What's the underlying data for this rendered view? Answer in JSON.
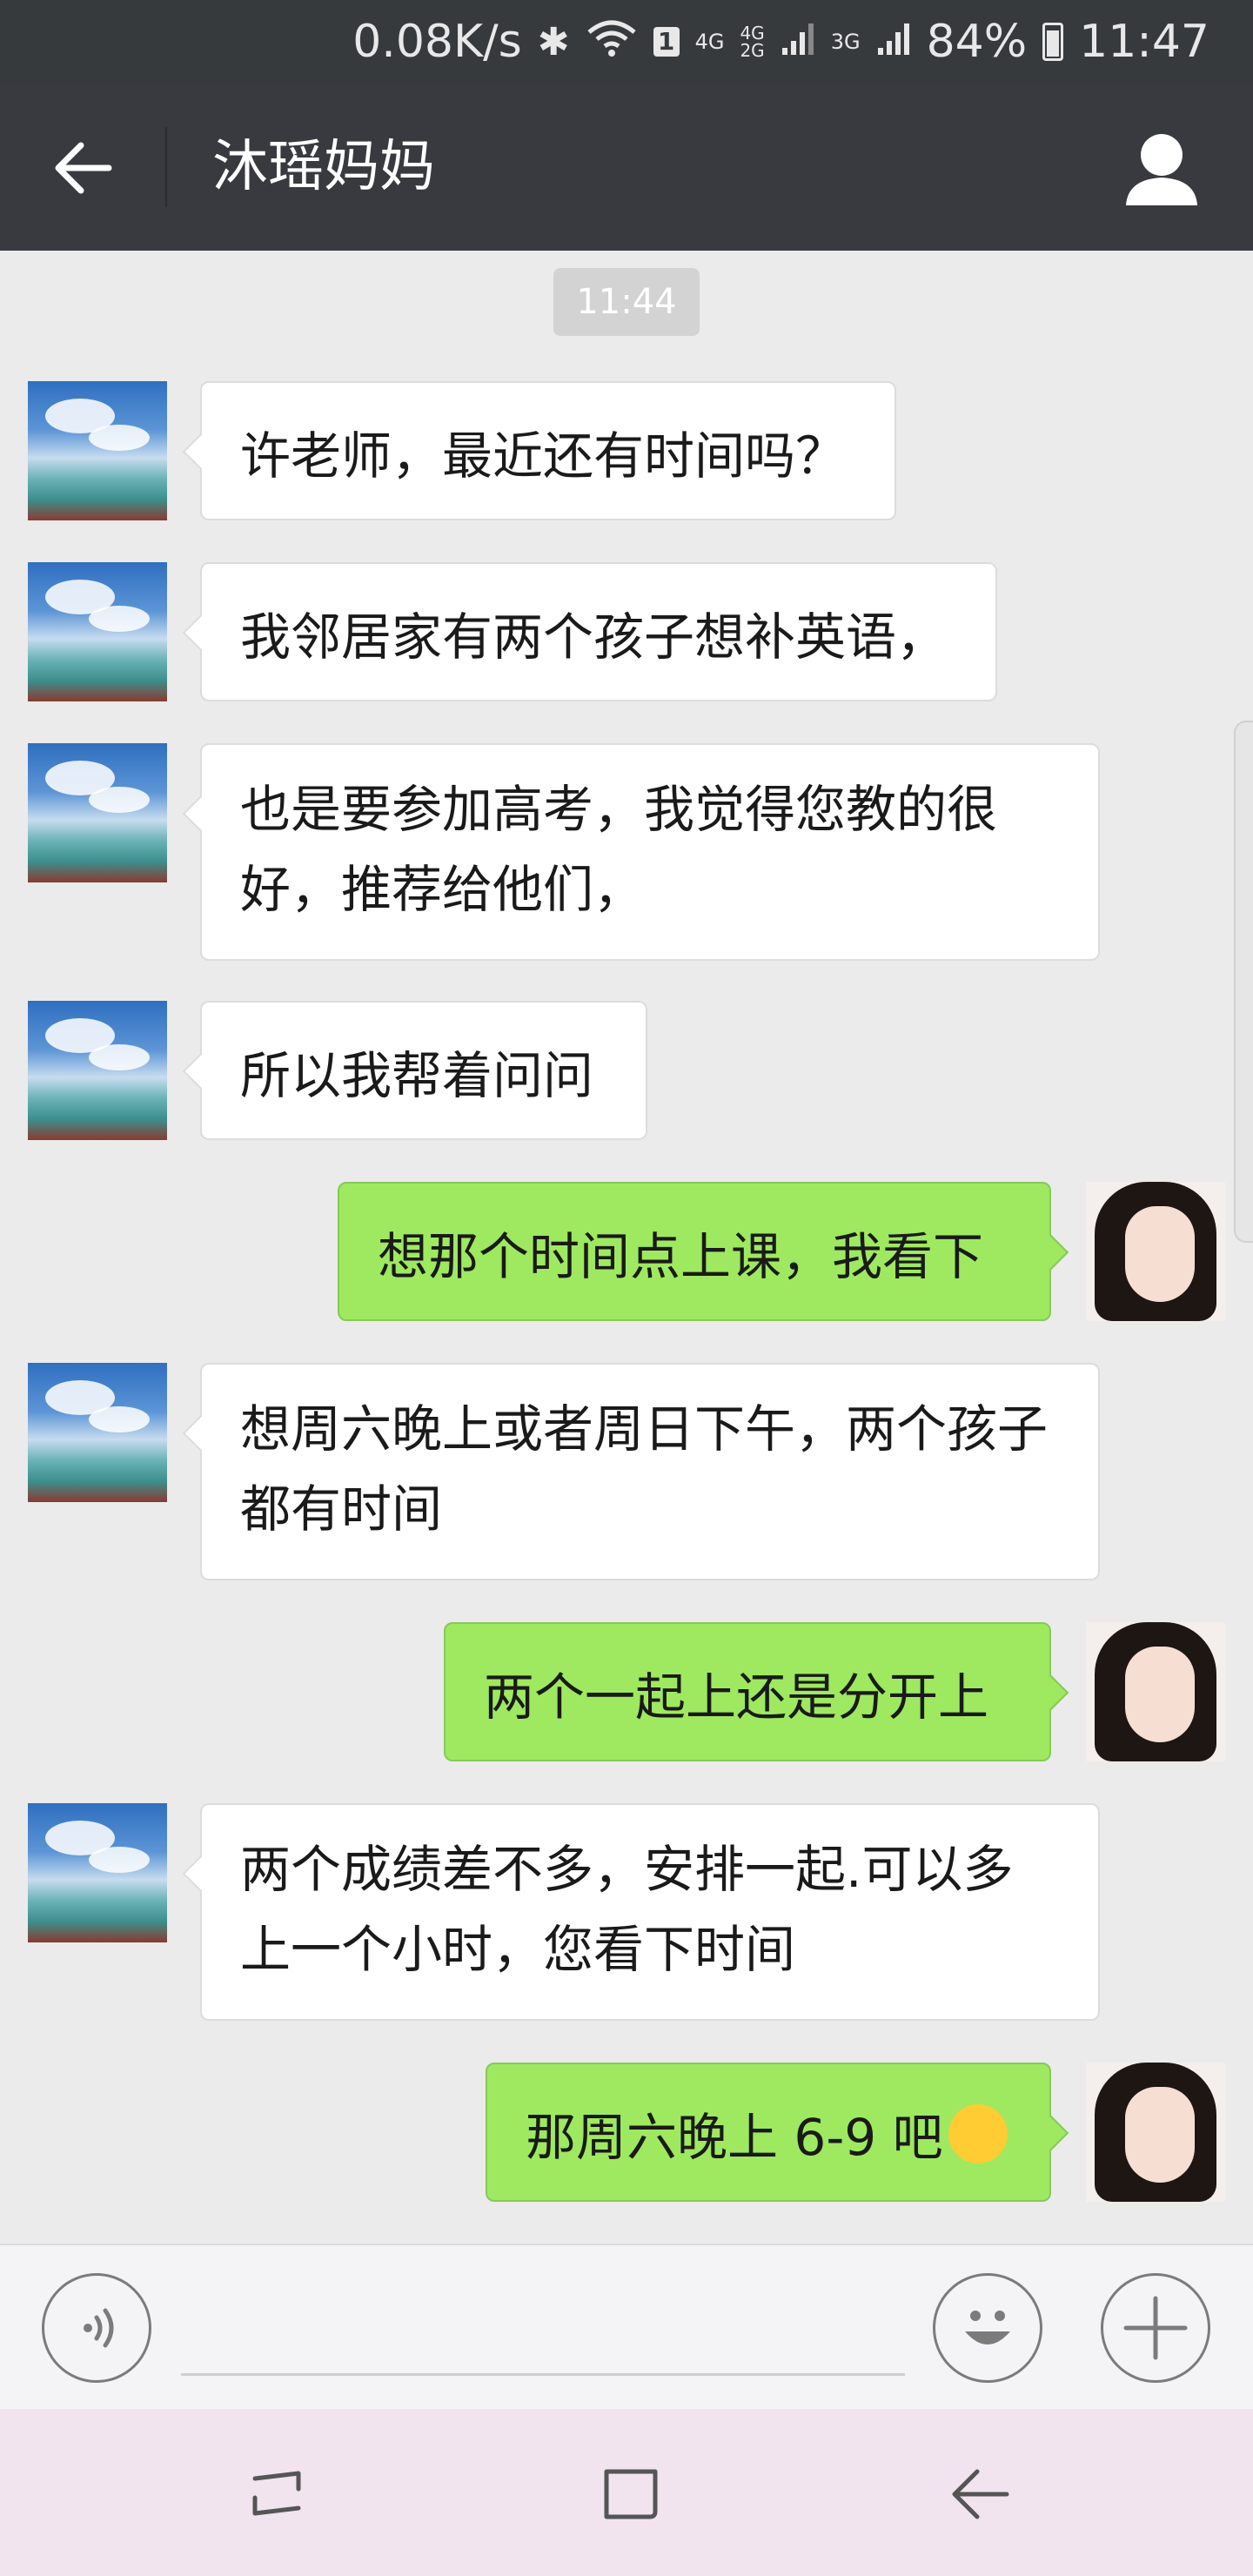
{
  "status_bar": {
    "net_speed": "0.08K/s",
    "sim_badge": "1",
    "net1": "4G",
    "net2_top": "4G",
    "net2_bottom": "2G",
    "net3": "3G",
    "battery": "84%",
    "time": "11:47"
  },
  "header": {
    "title": "沐瑶妈妈"
  },
  "chat": {
    "timestamp": "11:44",
    "messages": [
      {
        "side": "left",
        "text": "许老师，最近还有时间吗？"
      },
      {
        "side": "left",
        "text": "我邻居家有两个孩子想补英语，"
      },
      {
        "side": "left",
        "text": "也是要参加高考，我觉得您教的很好，推荐给他们，"
      },
      {
        "side": "left",
        "text": "所以我帮着问问"
      },
      {
        "side": "right",
        "text": "想那个时间点上课，我看下"
      },
      {
        "side": "left",
        "text": "想周六晚上或者周日下午，两个孩子都有时间"
      },
      {
        "side": "right",
        "text": "两个一起上还是分开上"
      },
      {
        "side": "left",
        "text": "两个成绩差不多，安排一起.可以多上一个小时，您看下时间"
      },
      {
        "side": "right",
        "text": "那周六晚上 6-9 吧"
      }
    ]
  },
  "input": {
    "value": ""
  },
  "icons": {
    "back": "back-arrow-icon",
    "profile": "person-icon",
    "voice": "voice-icon",
    "emoji": "emoji-icon",
    "plus": "plus-icon",
    "smile_emoji": "smiling-face-emoji"
  },
  "colors": {
    "header_bg": "#393a3f",
    "status_bg": "#373a3d",
    "chat_bg": "#ebebeb",
    "sent_bubble": "#9ee95f",
    "received_bubble": "#ffffff",
    "nav_bg": "#f1e4ee"
  }
}
